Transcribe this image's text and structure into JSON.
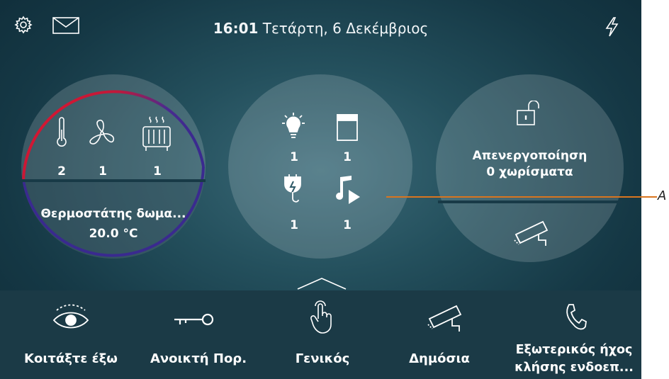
{
  "header": {
    "time": "16:01",
    "date": "Τετάρτη, 6 Δεκέμβριος",
    "icons": [
      "gear-icon",
      "envelope-icon",
      "lightning-icon"
    ]
  },
  "thermo_widget": {
    "counts": [
      "2",
      "1",
      "1"
    ],
    "icons": [
      "thermometer-icon",
      "fan-icon",
      "radiator-icon"
    ],
    "name": "Θερμοστάτης δωμα...",
    "temperature": "20.0 °C",
    "ring_colors": [
      "#e3162b",
      "#3a2a8f"
    ]
  },
  "devices_widget": {
    "items": [
      {
        "icon": "lightbulb-icon",
        "count": "1"
      },
      {
        "icon": "shutter-icon",
        "count": "1"
      },
      {
        "icon": "plug-icon",
        "count": "1"
      },
      {
        "icon": "music-play-icon",
        "count": "1"
      }
    ]
  },
  "alarm_widget": {
    "icon": "unlocked-padlock-icon",
    "line1": "Απενεργοποίηση",
    "line2": "0 χωρίσματα",
    "camera_icon": "security-camera-icon"
  },
  "bottom_nav": [
    {
      "label": "Κοιτάξτε έξω",
      "icon": "eye-icon"
    },
    {
      "label": "Ανοικτή Πορ.",
      "icon": "key-icon"
    },
    {
      "label": "Γενικός",
      "icon": "touch-hand-icon"
    },
    {
      "label": "Δημόσια",
      "icon": "security-camera-icon"
    },
    {
      "label": "Εξωτερικός ήχος κλήσης ενδοεπ...",
      "icon": "phone-icon"
    }
  ],
  "annotation": {
    "label": "A",
    "color": "#d9751f"
  }
}
